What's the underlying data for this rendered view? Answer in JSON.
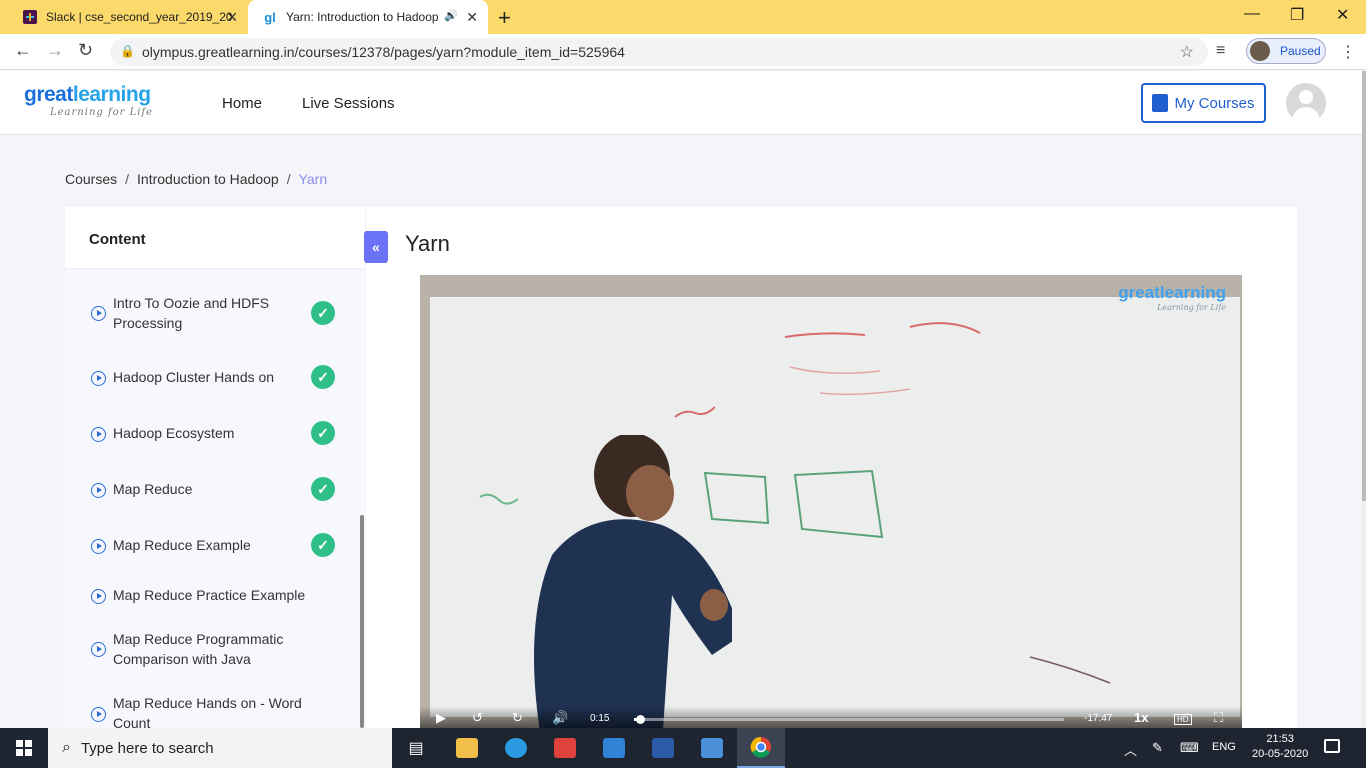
{
  "browser": {
    "tabs": [
      {
        "title": "Slack | cse_second_year_2019_20",
        "close": "✕"
      },
      {
        "title": "Yarn: Introduction to Hadoop",
        "close": "✕"
      }
    ],
    "new_tab": "+",
    "url": "olympus.greatlearning.in/courses/12378/pages/yarn?module_item_id=525964",
    "profile_label": "Paused",
    "window_controls": {
      "minimize": "—",
      "maximize": "❐",
      "close": "✕"
    },
    "nav": {
      "back": "←",
      "forward": "→",
      "reload": "↻"
    }
  },
  "site": {
    "brand_part1": "great",
    "brand_part2": "learning",
    "tagline": "Learning for Life",
    "nav": {
      "home": "Home",
      "live_sessions": "Live Sessions"
    },
    "my_courses": "My Courses"
  },
  "breadcrumb": {
    "root": "Courses",
    "course": "Introduction to Hadoop",
    "current": "Yarn",
    "sep": "/"
  },
  "sidebar": {
    "title": "Content",
    "items": [
      {
        "label": "Intro To Oozie and HDFS Processing",
        "completed": true
      },
      {
        "label": "Hadoop Cluster Hands on",
        "completed": true
      },
      {
        "label": "Hadoop Ecosystem",
        "completed": true
      },
      {
        "label": "Map Reduce",
        "completed": true
      },
      {
        "label": "Map Reduce Example",
        "completed": true
      },
      {
        "label": "Map Reduce Practice Example",
        "completed": false
      },
      {
        "label": "Map Reduce Programmatic Comparison with Java",
        "completed": false
      },
      {
        "label": "Map Reduce Hands on - Word Count",
        "completed": false
      }
    ],
    "collapse_label": "«",
    "check_glyph": "✓"
  },
  "page": {
    "title": "Yarn"
  },
  "video": {
    "watermark_part1": "great",
    "watermark_part2": "learning",
    "watermark_tagline": "Learning for Life",
    "current_time": "0:15",
    "remaining_time": "-17:47",
    "speed": "1x",
    "quality": "HD",
    "progress_fraction": 0.014
  },
  "taskbar": {
    "search_placeholder": "Type here to search",
    "language": "ENG",
    "time": "21:53",
    "date": "20-05-2020"
  }
}
